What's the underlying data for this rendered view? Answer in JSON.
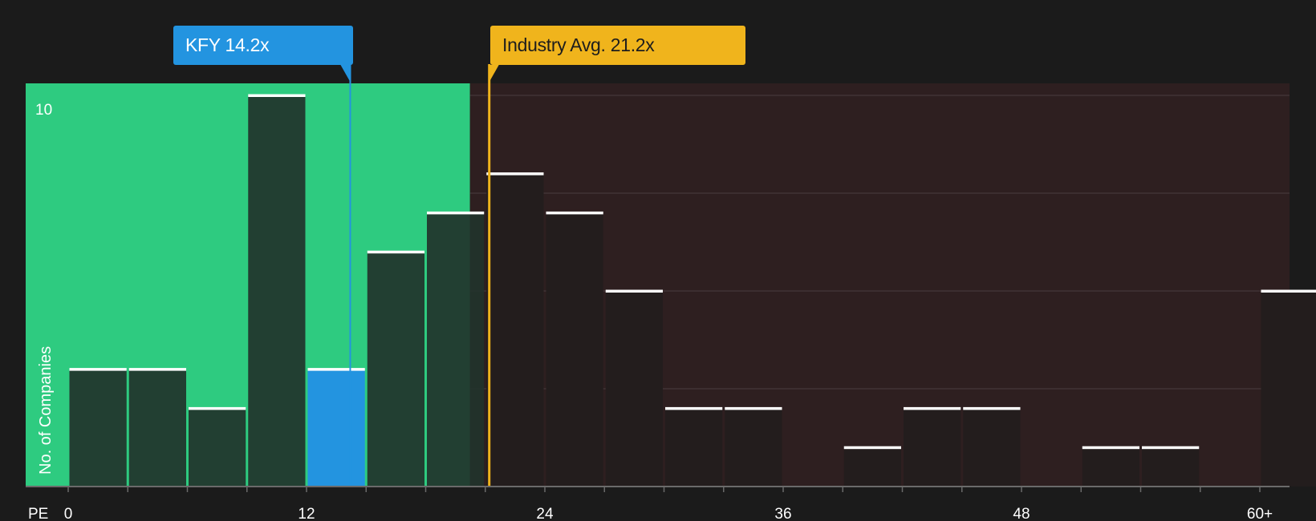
{
  "colors": {
    "background": "#1b1b1b",
    "undervalued_zone": "#2ecb80",
    "overvalued_zone": "#2e1f20",
    "company": "#2394e0",
    "industry": "#f0b41c",
    "bar_dark": "#22332b",
    "bar_right": "#231d1d",
    "bar_cap": "#ffffff",
    "text": "#ffffff"
  },
  "company": {
    "ticker": "KFY",
    "pe": 14.2,
    "label": "KFY 14.2x"
  },
  "industry": {
    "pe": 21.2,
    "label": "Industry Avg. 21.2x"
  },
  "chart_data": {
    "type": "bar",
    "xlabel": "PE",
    "ylabel": "No. of Companies",
    "x_ticks": [
      "0",
      "12",
      "24",
      "36",
      "48",
      "60+"
    ],
    "y_ticks": [
      "10"
    ],
    "xlim": [
      0,
      61
    ],
    "ylim": [
      0,
      10.4
    ],
    "bin_width": 3,
    "bins_start": [
      0,
      3,
      6,
      9,
      12,
      15,
      18,
      21,
      24,
      27,
      30,
      33,
      36,
      39,
      42,
      45,
      48,
      51,
      54,
      57,
      60
    ],
    "values": [
      3,
      3,
      2,
      10,
      3,
      6,
      7,
      8,
      7,
      5,
      2,
      2,
      0,
      1,
      2,
      2,
      0,
      1,
      1,
      0,
      5
    ],
    "highlight_bin_start": 12,
    "company_pe": 14.2,
    "industry_pe": 21.2,
    "grid": true,
    "grid_values": [
      2.5,
      5,
      7.5,
      10
    ]
  }
}
